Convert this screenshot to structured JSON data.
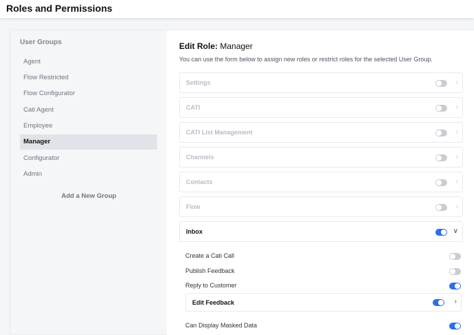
{
  "header": {
    "title": "Roles and Permissions"
  },
  "sidebar": {
    "heading": "User Groups",
    "items": [
      {
        "label": "Agent",
        "active": false
      },
      {
        "label": "Flow Restricted",
        "active": false
      },
      {
        "label": "Flow Configurator",
        "active": false
      },
      {
        "label": "Cati Agent",
        "active": false
      },
      {
        "label": "Employee",
        "active": false
      },
      {
        "label": "Manager",
        "active": true
      },
      {
        "label": "Configurator",
        "active": false
      },
      {
        "label": "Admin",
        "active": false
      }
    ],
    "add_group_label": "Add a New Group"
  },
  "main": {
    "title_prefix": "Edit Role:",
    "title_role": "Manager",
    "description": "You can use the form below to assign new roles or restrict roles for the selected User Group.",
    "sections": [
      {
        "label": "Settings",
        "enabled": false,
        "expanded": false
      },
      {
        "label": "CATI",
        "enabled": false,
        "expanded": false
      },
      {
        "label": "CATI List Management",
        "enabled": false,
        "expanded": false
      },
      {
        "label": "Channels",
        "enabled": false,
        "expanded": false
      },
      {
        "label": "Contacts",
        "enabled": false,
        "expanded": false
      },
      {
        "label": "Flow",
        "enabled": false,
        "expanded": false
      },
      {
        "label": "Inbox",
        "enabled": true,
        "expanded": true
      }
    ],
    "inbox_permissions": [
      {
        "label": "Create a Cati Call",
        "enabled": false
      },
      {
        "label": "Publish Feedback",
        "enabled": false
      },
      {
        "label": "Reply to Customer",
        "enabled": true
      }
    ],
    "edit_feedback": {
      "label": "Edit Feedback",
      "enabled": true
    },
    "extra_permissions": [
      {
        "label": "Can Display Masked Data",
        "enabled": true
      }
    ]
  },
  "icons": {
    "collapsed": "chevron-right-icon",
    "expanded": "chevron-down-icon"
  },
  "colors": {
    "toggle_on": "#2f6fe4",
    "toggle_off": "#c9ccd2",
    "active_item_bg": "#e1e3e8"
  }
}
